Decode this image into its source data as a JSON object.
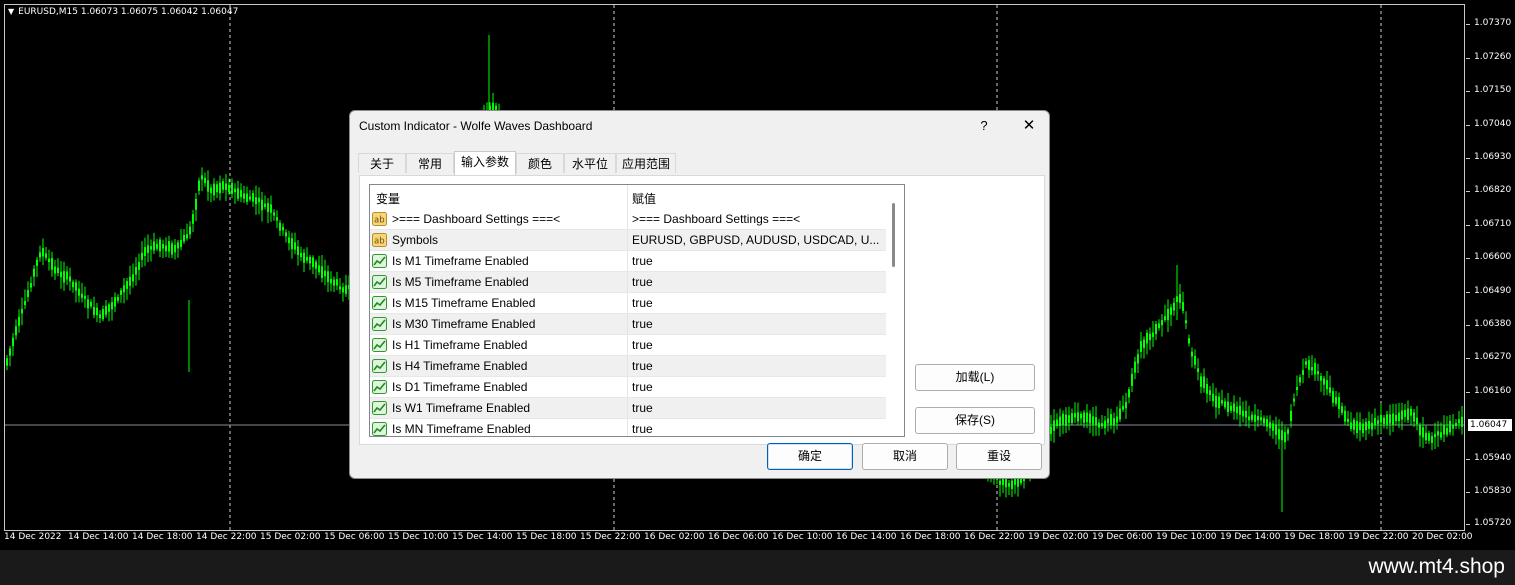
{
  "chart": {
    "symbol_info": "EURUSD,M15  1.06073 1.06075 1.06042 1.06047",
    "current_price": "1.06047",
    "price_ticks": [
      "1.07370",
      "1.07260",
      "1.07150",
      "1.07040",
      "1.06930",
      "1.06820",
      "1.06710",
      "1.06600",
      "1.06490",
      "1.06380",
      "1.06270",
      "1.06160",
      "1.05940",
      "1.05830",
      "1.05720"
    ],
    "time_ticks": [
      "14 Dec 2022",
      "14 Dec 14:00",
      "14 Dec 18:00",
      "14 Dec 22:00",
      "15 Dec 02:00",
      "15 Dec 06:00",
      "15 Dec 10:00",
      "15 Dec 14:00",
      "15 Dec 18:00",
      "15 Dec 22:00",
      "16 Dec 02:00",
      "16 Dec 06:00",
      "16 Dec 10:00",
      "16 Dec 14:00",
      "16 Dec 18:00",
      "16 Dec 22:00",
      "19 Dec 02:00",
      "19 Dec 06:00",
      "19 Dec 10:00",
      "19 Dec 14:00",
      "19 Dec 18:00",
      "19 Dec 22:00",
      "20 Dec 02:00"
    ],
    "candle_color": "#00ff00",
    "background": "#000000"
  },
  "dialog": {
    "title": "Custom Indicator - Wolfe Waves Dashboard",
    "help_label": "?",
    "close_label": "✕",
    "tabs": [
      {
        "label": "关于",
        "active": false
      },
      {
        "label": "常用",
        "active": false
      },
      {
        "label": "输入参数",
        "active": true
      },
      {
        "label": "颜色",
        "active": false
      },
      {
        "label": "水平位",
        "active": false
      },
      {
        "label": "应用范围",
        "active": false
      }
    ],
    "grid": {
      "col_variable": "变量",
      "col_value": "赋值",
      "rows": [
        {
          "icon": "ab-icon",
          "name": ">=== Dashboard Settings ===<",
          "value": ">=== Dashboard Settings ===<"
        },
        {
          "icon": "ab-icon",
          "name": "Symbols",
          "value": "EURUSD, GBPUSD, AUDUSD, USDCAD, U..."
        },
        {
          "icon": "bool-icon",
          "name": "Is M1 Timeframe Enabled",
          "value": "true"
        },
        {
          "icon": "bool-icon",
          "name": "Is M5 Timeframe Enabled",
          "value": "true"
        },
        {
          "icon": "bool-icon",
          "name": "Is M15 Timeframe Enabled",
          "value": "true"
        },
        {
          "icon": "bool-icon",
          "name": "Is M30 Timeframe Enabled",
          "value": "true"
        },
        {
          "icon": "bool-icon",
          "name": "Is H1 Timeframe Enabled",
          "value": "true"
        },
        {
          "icon": "bool-icon",
          "name": "Is H4 Timeframe Enabled",
          "value": "true"
        },
        {
          "icon": "bool-icon",
          "name": "Is D1 Timeframe Enabled",
          "value": "true"
        },
        {
          "icon": "bool-icon",
          "name": "Is W1 Timeframe Enabled",
          "value": "true"
        },
        {
          "icon": "bool-icon",
          "name": "Is MN Timeframe Enabled",
          "value": "true"
        }
      ]
    },
    "load_button": "加载(L)",
    "save_button": "保存(S)",
    "ok_button": "确定",
    "cancel_button": "取消",
    "reset_button": "重设"
  },
  "footer": {
    "brand": "www.mt4.shop"
  }
}
